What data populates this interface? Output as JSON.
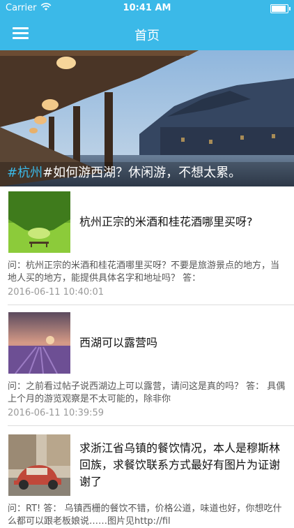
{
  "status_bar": {
    "carrier": "Carrier",
    "time": "10:41 AM",
    "battery_level": 0.95
  },
  "nav": {
    "title": "首页"
  },
  "banner": {
    "tag": "#杭州",
    "text": "#如何游西湖？休闲游，不想太累。"
  },
  "posts": [
    {
      "title": "杭州正宗的米酒和桂花酒哪里买呀?",
      "excerpt": "问：杭州正宗的米酒和桂花酒哪里买呀？不要是旅游景点的地方，当地人买的地方，能提供具体名字和地址吗？ 答：",
      "date": "2016-06-11 10:40:01"
    },
    {
      "title": "西湖可以露营吗",
      "excerpt": "问：之前看过帖子说西湖边上可以露营，请问这是真的吗？ 答： 具偶上个月的游览观察是不太可能的，除非你",
      "date": "2016-06-11 10:39:59"
    },
    {
      "title": "求浙江省乌镇的餐饮情况，本人是穆斯林回族，求餐饮联系方式最好有图片为证谢谢了",
      "excerpt": "问：RT! 答： 乌镇西栅的餐饮不错，价格公道，味道也好，你想吃什么都可以跟老板娘说……图片见http://fil",
      "date": ""
    }
  ]
}
